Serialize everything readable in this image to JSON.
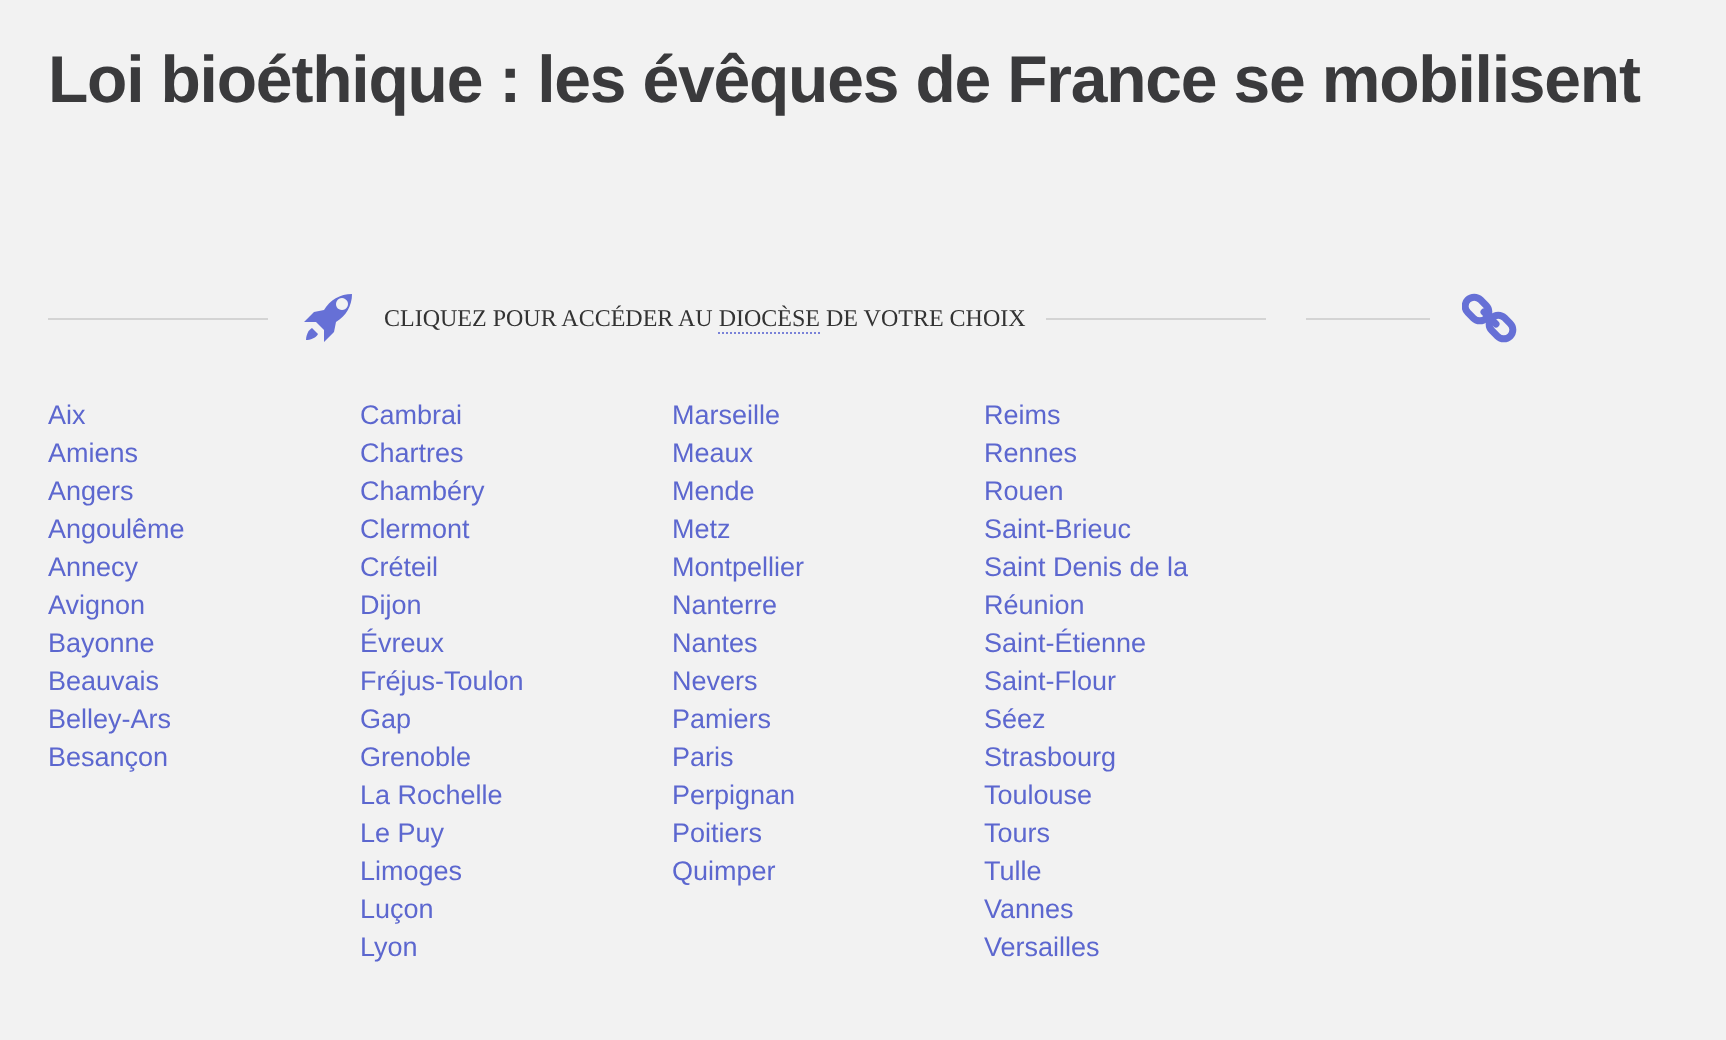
{
  "title": "Loi bioéthique : les évêques de France se mobilisent",
  "banner": {
    "before": "CLIQUEZ POUR ACCÉDER AU ",
    "term": "DIOCÈSE",
    "after": " DE VOTRE CHOIX"
  },
  "columns": [
    [
      "Aix",
      "Amiens",
      "Angers",
      "Angoulême",
      "Annecy",
      "Avignon",
      "Bayonne",
      "Beauvais",
      "Belley-Ars",
      "Besançon"
    ],
    [
      "Cambrai",
      "Chartres",
      "Chambéry",
      "Clermont",
      "Créteil",
      "Dijon",
      "Évreux",
      "Fréjus-Toulon",
      "Gap",
      "Grenoble",
      "La Rochelle",
      "Le Puy",
      "Limoges",
      "Luçon",
      "Lyon"
    ],
    [
      "Marseille",
      "Meaux",
      "Mende",
      "Metz",
      "Montpellier",
      "Nanterre",
      "Nantes",
      "Nevers",
      "Pamiers",
      "Paris",
      "Perpignan",
      "Poitiers",
      "Quimper"
    ],
    [
      "Reims",
      "Rennes",
      "Rouen",
      "Saint-Brieuc",
      "Saint Denis de la Réunion",
      "Saint-Étienne",
      "Saint-Flour",
      "Séez",
      "Strasbourg",
      "Toulouse",
      "Tours",
      "Tulle",
      "Vannes",
      "Versailles"
    ]
  ]
}
